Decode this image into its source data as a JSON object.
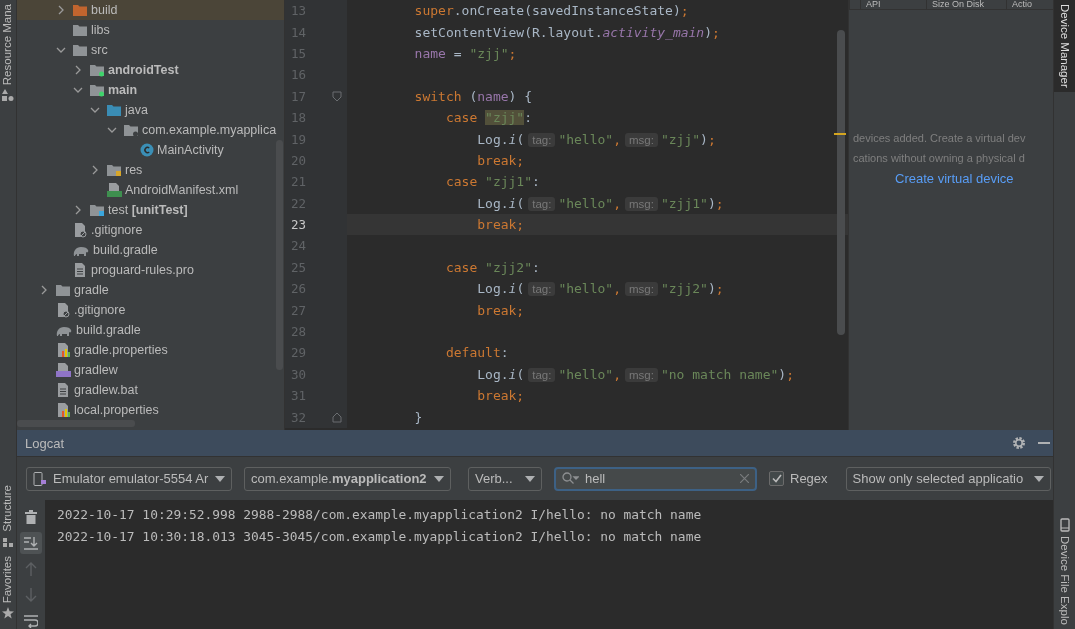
{
  "left_strip": {
    "tabs": [
      {
        "label": "Resource Mana",
        "kind": "resource",
        "selected": false
      },
      {
        "label": "Structure",
        "kind": "structure",
        "selected": false
      },
      {
        "label": "Favorites",
        "kind": "favorites",
        "selected": false
      }
    ]
  },
  "project_tree": {
    "partial_children": [
      {
        "label": "build",
        "kind": "build_folder",
        "expanded": false,
        "bold": false,
        "selected": true
      },
      {
        "label": "libs",
        "kind": "folder",
        "bold": false,
        "selected": false
      },
      {
        "label": "src",
        "kind": "folder",
        "expanded": true,
        "bold": false,
        "selected": false,
        "children": [
          {
            "label": "androidTest",
            "kind": "module_folder",
            "expanded": false,
            "bold": true,
            "selected": false
          },
          {
            "label": "main",
            "kind": "module_folder",
            "expanded": true,
            "bold": true,
            "selected": false,
            "children": [
              {
                "label": "java",
                "kind": "source_folder",
                "expanded": true,
                "bold": false,
                "selected": false,
                "children": [
                  {
                    "label": "com.example.myapplica",
                    "kind": "package",
                    "expanded": true,
                    "bold": false,
                    "selected": false,
                    "children": [
                      {
                        "label": "MainActivity",
                        "kind": "class",
                        "bold": false,
                        "selected": false
                      }
                    ]
                  }
                ]
              },
              {
                "label": "res",
                "kind": "resource_folder",
                "expanded": false,
                "bold": false,
                "selected": false
              },
              {
                "label": "AndroidManifest.xml",
                "kind": "manifest",
                "bold": false,
                "selected": false
              }
            ]
          },
          {
            "label": "test **[unitTest]**",
            "kind": "test_folder",
            "expanded": false,
            "bold": false,
            "selected": false
          }
        ]
      },
      {
        "label": ".gitignore",
        "kind": "ignore_file",
        "bold": false,
        "selected": false
      },
      {
        "label": "build.gradle",
        "kind": "gradle_file",
        "bold": false,
        "selected": false
      },
      {
        "label": "proguard-rules.pro",
        "kind": "text_file",
        "bold": false,
        "selected": false
      }
    ],
    "items": [
      {
        "label": "gradle",
        "kind": "folder",
        "expanded": false,
        "bold": false,
        "selected": false
      },
      {
        "label": ".gitignore",
        "kind": "ignore_file",
        "bold": false,
        "selected": false
      },
      {
        "label": "build.gradle",
        "kind": "gradle_file",
        "bold": false,
        "selected": false
      },
      {
        "label": "gradle.properties",
        "kind": "properties",
        "bold": false,
        "selected": false
      },
      {
        "label": "gradlew",
        "kind": "script",
        "bold": false,
        "selected": false
      },
      {
        "label": "gradlew.bat",
        "kind": "text_file",
        "bold": false,
        "selected": false
      },
      {
        "label": "local.properties",
        "kind": "properties",
        "bold": false,
        "selected": false
      }
    ]
  },
  "editor": {
    "lines": [
      {
        "number": "13",
        "kind": "code",
        "current": false,
        "tokens": [
          {
            "kind": "keyword",
            "text": "        super"
          },
          {
            "kind": "plain",
            "text": ".onCreate(savedInstanceState)"
          },
          {
            "kind": "keyword",
            "text": ";"
          }
        ]
      },
      {
        "number": "14",
        "kind": "code",
        "current": false,
        "tokens": [
          {
            "kind": "plain",
            "text": "        setContentView(R.layout."
          },
          {
            "kind": "constant",
            "text": "activity_main"
          },
          {
            "kind": "plain",
            "text": ")"
          },
          {
            "kind": "keyword",
            "text": ";"
          }
        ]
      },
      {
        "number": "15",
        "kind": "code",
        "current": false,
        "tokens": [
          {
            "kind": "field",
            "text": "        name"
          },
          {
            "kind": "plain",
            "text": " = "
          },
          {
            "kind": "string",
            "text": "\"zjj\""
          },
          {
            "kind": "keyword",
            "text": ";"
          }
        ]
      },
      {
        "number": "16",
        "kind": "code",
        "current": false
      },
      {
        "number": "17",
        "kind": "fold_start",
        "current": false,
        "tokens": [
          {
            "kind": "keyword",
            "text": "        switch"
          },
          {
            "kind": "plain",
            "text": " ("
          },
          {
            "kind": "field",
            "text": "name"
          },
          {
            "kind": "plain",
            "text": ") {"
          }
        ]
      },
      {
        "number": "18",
        "kind": "code",
        "current": false,
        "tokens": [
          {
            "kind": "keyword",
            "text": "            case "
          },
          {
            "kind": "match",
            "text": "\"zjj\""
          },
          {
            "kind": "plain",
            "text": ":"
          }
        ]
      },
      {
        "number": "19",
        "kind": "code",
        "current": false,
        "tokens": [
          {
            "kind": "plain",
            "text": "                Log."
          },
          {
            "kind": "method",
            "text": "i"
          },
          {
            "kind": "plain",
            "text": "("
          },
          {
            "kind": "hint",
            "text": "tag:"
          },
          {
            "kind": "string",
            "text": "\"hello\""
          },
          {
            "kind": "keyword",
            "text": ","
          },
          {
            "kind": "hint",
            "text": "msg:"
          },
          {
            "kind": "string",
            "text": "\"zjj\""
          },
          {
            "kind": "plain",
            "text": ")"
          },
          {
            "kind": "keyword",
            "text": ";"
          }
        ]
      },
      {
        "number": "20",
        "kind": "code",
        "current": false,
        "tokens": [
          {
            "kind": "keyword",
            "text": "                break;"
          }
        ]
      },
      {
        "number": "21",
        "kind": "code",
        "current": false,
        "tokens": [
          {
            "kind": "keyword",
            "text": "            case "
          },
          {
            "kind": "string",
            "text": "\"zjj1\""
          },
          {
            "kind": "plain",
            "text": ":"
          }
        ]
      },
      {
        "number": "22",
        "kind": "code",
        "current": false,
        "tokens": [
          {
            "kind": "plain",
            "text": "                Log."
          },
          {
            "kind": "method",
            "text": "i"
          },
          {
            "kind": "plain",
            "text": "("
          },
          {
            "kind": "hint",
            "text": "tag:"
          },
          {
            "kind": "string",
            "text": "\"hello\""
          },
          {
            "kind": "keyword",
            "text": ","
          },
          {
            "kind": "hint",
            "text": "msg:"
          },
          {
            "kind": "string",
            "text": "\"zjj1\""
          },
          {
            "kind": "plain",
            "text": ")"
          },
          {
            "kind": "keyword",
            "text": ";"
          }
        ]
      },
      {
        "number": "23",
        "kind": "code",
        "current": true,
        "tokens": [
          {
            "kind": "keyword",
            "text": "                break;"
          }
        ]
      },
      {
        "number": "24",
        "kind": "code",
        "current": false
      },
      {
        "number": "25",
        "kind": "code",
        "current": false,
        "tokens": [
          {
            "kind": "keyword",
            "text": "            case "
          },
          {
            "kind": "string",
            "text": "\"zjj2\""
          },
          {
            "kind": "plain",
            "text": ":"
          }
        ]
      },
      {
        "number": "26",
        "kind": "code",
        "current": false,
        "tokens": [
          {
            "kind": "plain",
            "text": "                Log."
          },
          {
            "kind": "method",
            "text": "i"
          },
          {
            "kind": "plain",
            "text": "("
          },
          {
            "kind": "hint",
            "text": "tag:"
          },
          {
            "kind": "string",
            "text": "\"hello\""
          },
          {
            "kind": "keyword",
            "text": ","
          },
          {
            "kind": "hint",
            "text": "msg:"
          },
          {
            "kind": "string",
            "text": "\"zjj2\""
          },
          {
            "kind": "plain",
            "text": ")"
          },
          {
            "kind": "keyword",
            "text": ";"
          }
        ]
      },
      {
        "number": "27",
        "kind": "code",
        "current": false,
        "tokens": [
          {
            "kind": "keyword",
            "text": "                break;"
          }
        ]
      },
      {
        "number": "28",
        "kind": "code",
        "current": false
      },
      {
        "number": "29",
        "kind": "code",
        "current": false,
        "tokens": [
          {
            "kind": "keyword",
            "text": "            default"
          },
          {
            "kind": "plain",
            "text": ":"
          }
        ]
      },
      {
        "number": "30",
        "kind": "code",
        "current": false,
        "tokens": [
          {
            "kind": "plain",
            "text": "                Log."
          },
          {
            "kind": "method",
            "text": "i"
          },
          {
            "kind": "plain",
            "text": "("
          },
          {
            "kind": "hint",
            "text": "tag:"
          },
          {
            "kind": "string",
            "text": "\"hello\""
          },
          {
            "kind": "keyword",
            "text": ","
          },
          {
            "kind": "hint",
            "text": "msg:"
          },
          {
            "kind": "string",
            "text": "\"no match name\""
          },
          {
            "kind": "plain",
            "text": ")"
          },
          {
            "kind": "keyword",
            "text": ";"
          }
        ]
      },
      {
        "number": "31",
        "kind": "code",
        "current": false,
        "tokens": [
          {
            "kind": "keyword",
            "text": "                break;"
          }
        ]
      },
      {
        "number": "32",
        "kind": "fold_end",
        "current": false,
        "tokens": [
          {
            "kind": "plain",
            "text": "        }"
          }
        ]
      }
    ]
  },
  "device_manager": {
    "columns": [
      "API",
      "Size On Disk",
      "Actio"
    ],
    "message_lines": [
      "devices added. Create a virtual dev",
      "cations without owning a physical d"
    ],
    "link": "Create virtual device"
  },
  "right_strip": {
    "tabs": [
      {
        "label": "Device Manager",
        "kind": "device_manager",
        "selected": true
      },
      {
        "label": "Device File Explo",
        "kind": "file_explorer",
        "selected": false
      }
    ]
  },
  "logcat": {
    "title": "Logcat",
    "device_dropdown": "Emulator emulator-5554 Ar",
    "package_dropdown": "com.example.**myapplication2**",
    "level_dropdown": "Verb...",
    "search": {
      "value": "hell"
    },
    "regex": {
      "label": "Regex",
      "checked": true
    },
    "filter_dropdown": "Show only selected applicatio",
    "tools": [
      {
        "kind": "clear",
        "selected": false,
        "disabled": false
      },
      {
        "kind": "scroll_end",
        "selected": true,
        "disabled": false
      },
      {
        "kind": "up",
        "selected": false,
        "disabled": true
      },
      {
        "kind": "down",
        "selected": false,
        "disabled": true
      },
      {
        "kind": "wrap",
        "selected": false,
        "disabled": false
      }
    ],
    "lines": [
      "2022-10-17 10:29:52.998 2988-2988/com.example.myapplication2 I/hello: no match name",
      "2022-10-17 10:30:18.013 3045-3045/com.example.myapplication2 I/hello: no match name"
    ]
  }
}
